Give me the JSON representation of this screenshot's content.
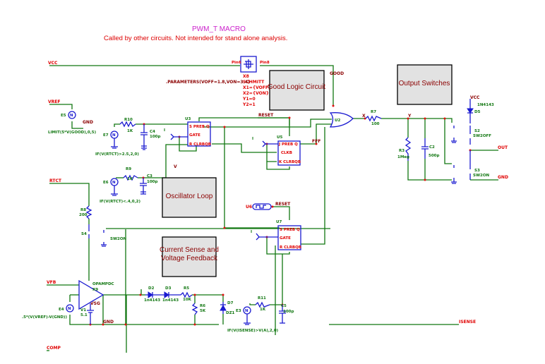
{
  "header": {
    "title": "PWM_T MACRO",
    "subtitle": "Called by other circuits.  Not intended for stand alone analysis."
  },
  "blocks": {
    "good_logic": "Good Logic Circuit",
    "output_switches": "Output Switches",
    "oscillator": "Oscillator Loop",
    "current_sense_1": "Current Sense and",
    "current_sense_2": "Voltage Feedback"
  },
  "ports": {
    "vcc": "VCC",
    "vref": "VREF",
    "rtct": "RTCT",
    "vfb": "VFB",
    "comp": "COMP",
    "out": "OUT",
    "gnd_out": "GND",
    "sense": "ISENSE",
    "vcc_out": "VCC"
  },
  "nets": {
    "good": "GOOD",
    "reset1": "RESET",
    "reset2": "RESET",
    "fff": "FFF",
    "gnd1": "GND",
    "gnd2": "GND",
    "vsg": "VSG",
    "x": "X",
    "y": "Y",
    "v": "V",
    "i1": "I",
    "i2": "I",
    "i3": "I"
  },
  "schmitt": {
    "pin_in": "Pin6",
    "pin_out": "Pin8",
    "ref": "X8",
    "type": "SCHMITT",
    "params": ".PARAMETERS(VOFF=1.8,VON=3.4)",
    "x1": "X1={VOFF}",
    "x2": "X2={VON}",
    "y1": "Y1=0",
    "y2": "Y2=1"
  },
  "components": {
    "e5": {
      "ref": "E5",
      "expr": "LIMIT(5*V(GOOD),0,5)"
    },
    "e7": {
      "ref": "E7",
      "expr": "IF(V(RTCT)>2.5,2,0)"
    },
    "e6": {
      "ref": "E6",
      "expr": "IF(V(RTCT)<.4,0,2)"
    },
    "e4": {
      "ref": "E4",
      "expr": ".5*(V(VREF)-V(GND))"
    },
    "e3": {
      "ref": "E3",
      "expr": "IF(V(ISENSE)>V(A),2,0)"
    },
    "r10": {
      "ref": "R10",
      "value": "1K"
    },
    "r9": {
      "ref": "R9",
      "value": "1K"
    },
    "r8": {
      "ref": "R8",
      "value": "200"
    },
    "r7": {
      "ref": "R7",
      "value": "100"
    },
    "r3": {
      "ref": "R3",
      "value": "1Meg"
    },
    "r5": {
      "ref": "R5",
      "value": "10K"
    },
    "r6": {
      "ref": "R6",
      "value": "5K"
    },
    "r11": {
      "ref": "R11",
      "value": "1K"
    },
    "c4": {
      "ref": "C4",
      "value": "100p"
    },
    "c3": {
      "ref": "C3",
      "value": "100p"
    },
    "c2": {
      "ref": "C2",
      "value": "500p"
    },
    "c5": {
      "ref": "C5",
      "value": "100p"
    },
    "u3": {
      "ref": "U3",
      "pins": [
        "S  PREB  Q",
        "GATE",
        "R  CLRBQB"
      ]
    },
    "u5": {
      "ref": "U5",
      "pins": [
        "J  PREB  Q",
        "CLKB",
        "K  CLRBQB"
      ]
    },
    "u7": {
      "ref": "U7",
      "pins": [
        "S  PREB  Q",
        "GATE",
        "R  CLRBQB"
      ]
    },
    "u2": {
      "ref": "U2"
    },
    "u6": {
      "ref": "U6"
    },
    "x9": {
      "ref": "X9",
      "type": "OPAMPDC"
    },
    "v1": {
      "ref": "V1",
      "value": "5.1"
    },
    "d2": {
      "ref": "D2",
      "value": "1n4143"
    },
    "d3": {
      "ref": "D3",
      "value": "1n4143"
    },
    "d5": {
      "ref": "D5",
      "value": "1N4143"
    },
    "d7": {
      "ref": "D7",
      "value": "DZ1"
    },
    "s2": {
      "ref": "S2",
      "value": "SW2OFF"
    },
    "s3": {
      "ref": "S3",
      "value": "SW2ON"
    },
    "s4": {
      "ref": "S4",
      "value": "SW2ON"
    }
  }
}
